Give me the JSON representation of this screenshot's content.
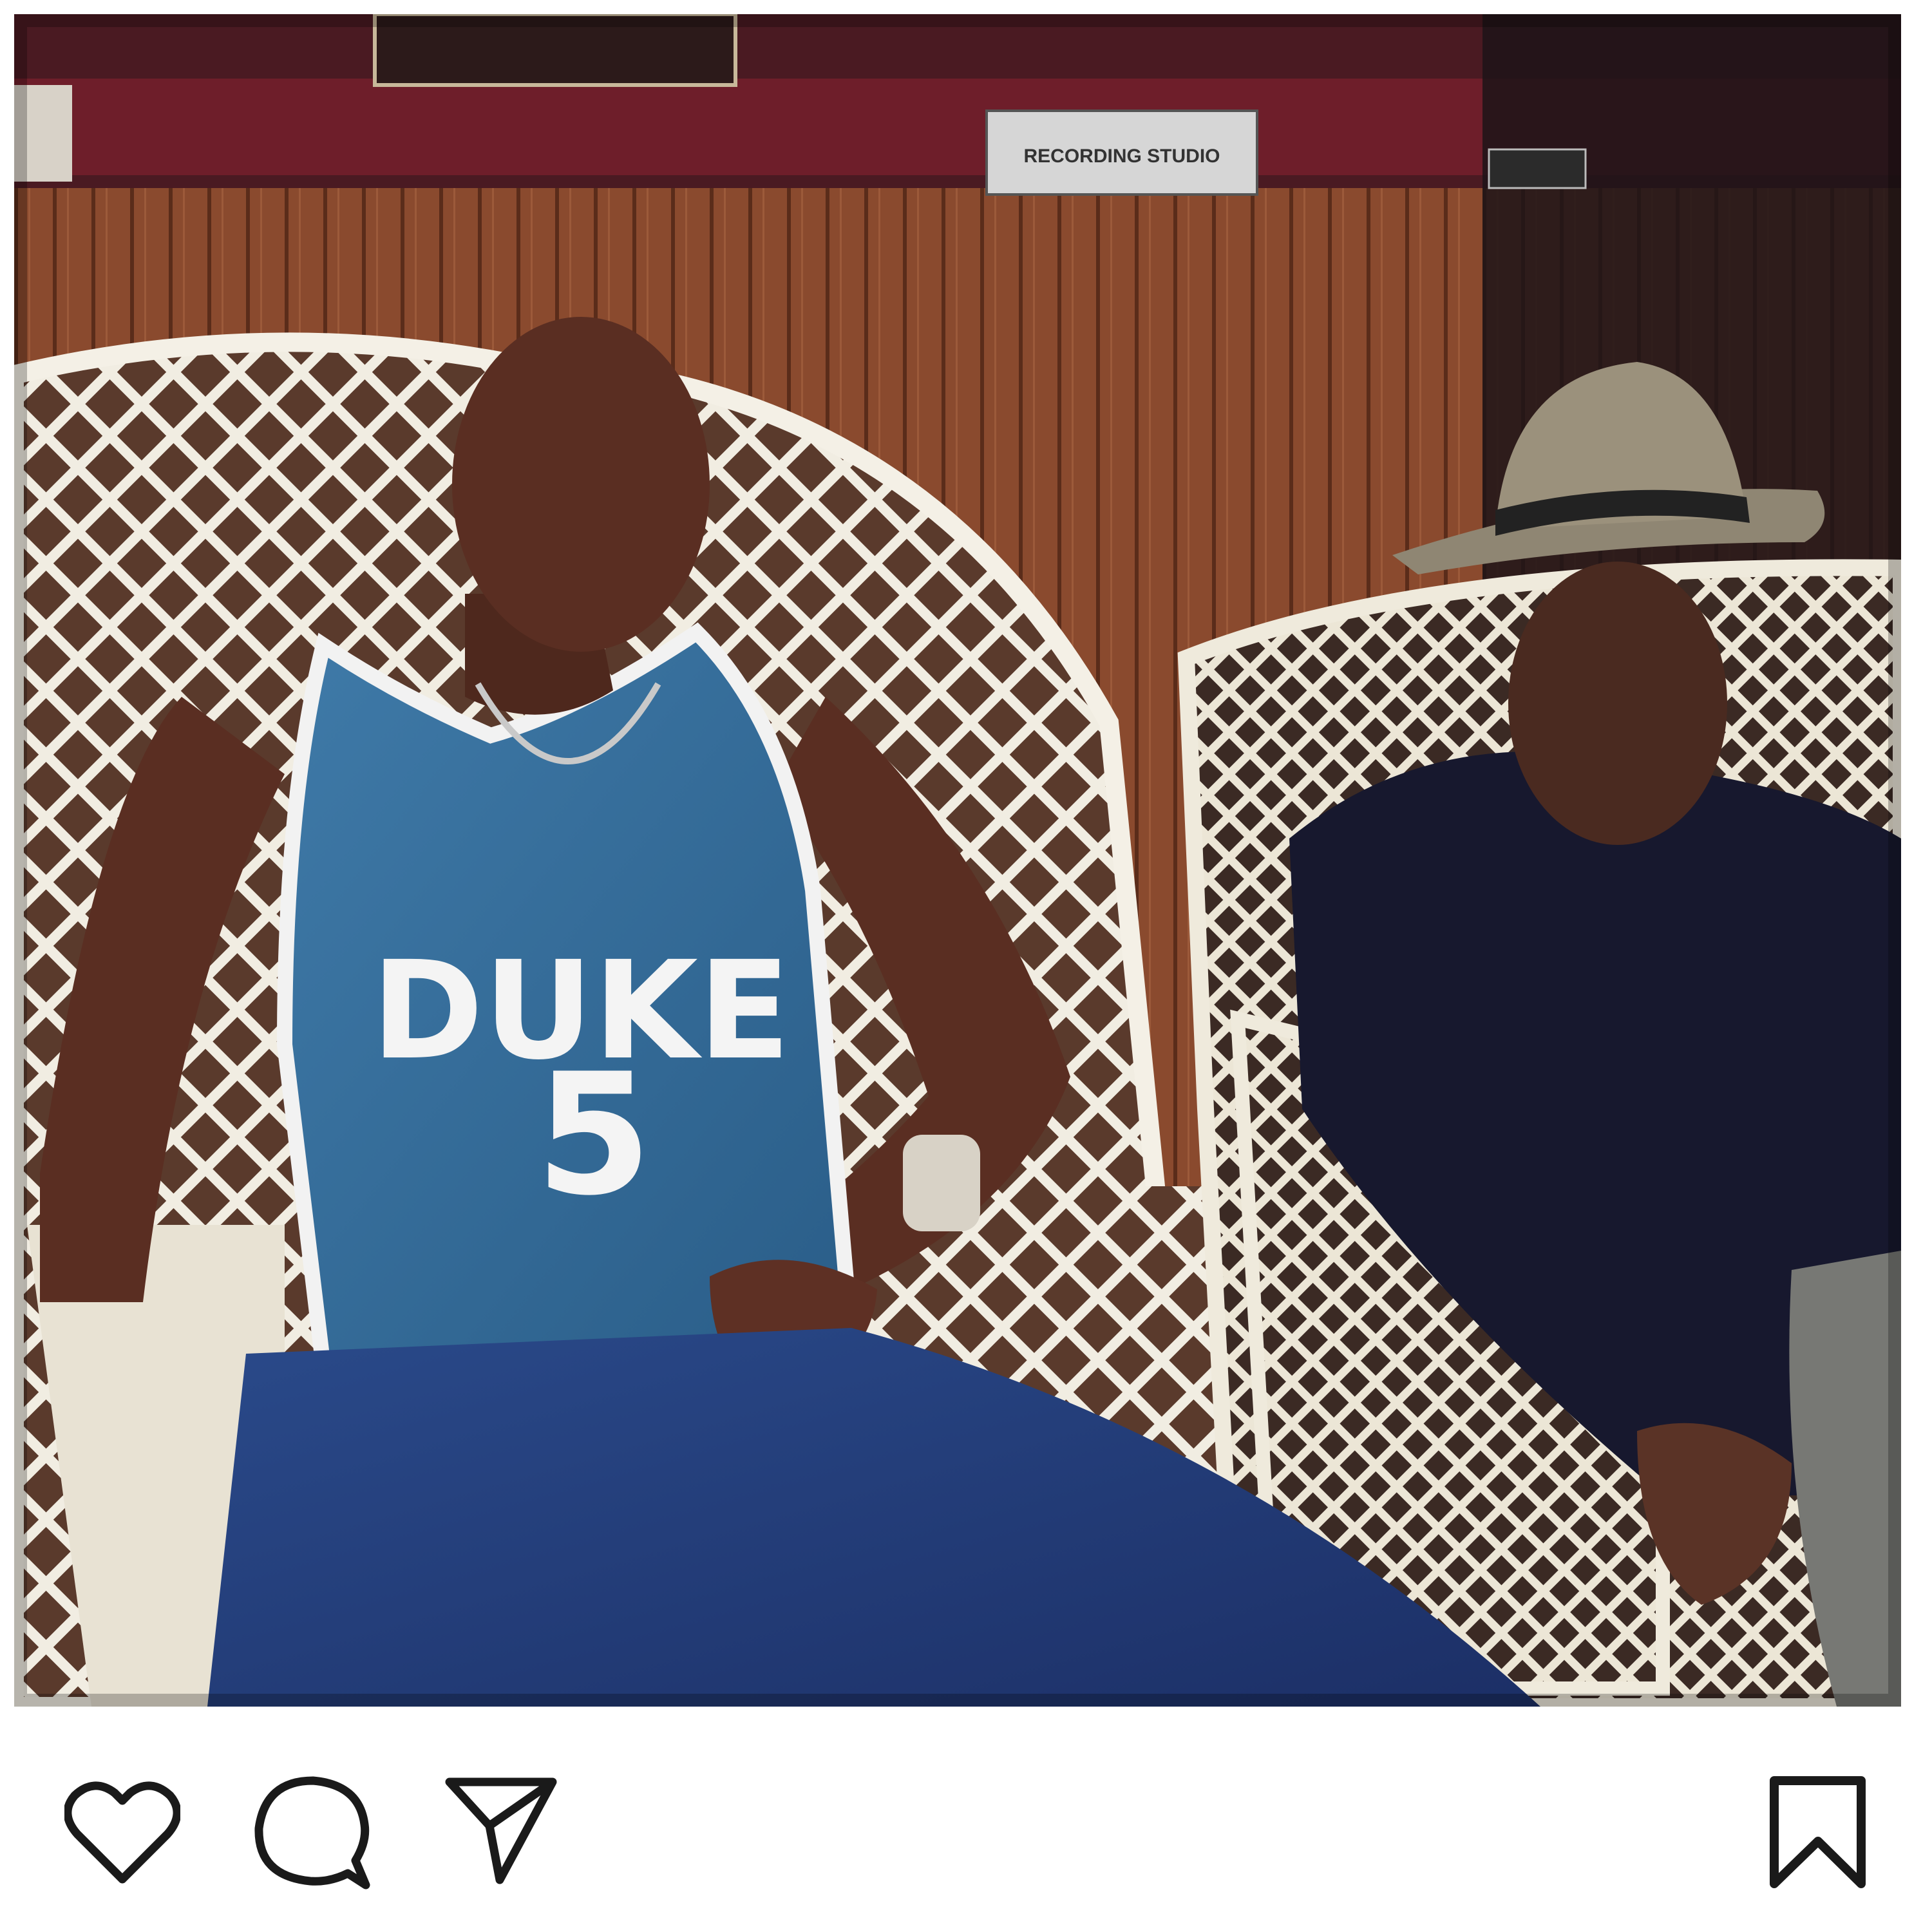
{
  "post": {
    "photo": {
      "description_icon": "photo",
      "jersey_team": "DUKE",
      "jersey_number": "5",
      "sign_text": "RECORDING STUDIO"
    },
    "actions": {
      "like_icon": "heart-icon",
      "comment_icon": "comment-icon",
      "share_icon": "paper-plane-icon",
      "save_icon": "bookmark-icon"
    }
  },
  "colors": {
    "icon_stroke": "#1a1a1a",
    "background": "#ffffff"
  }
}
